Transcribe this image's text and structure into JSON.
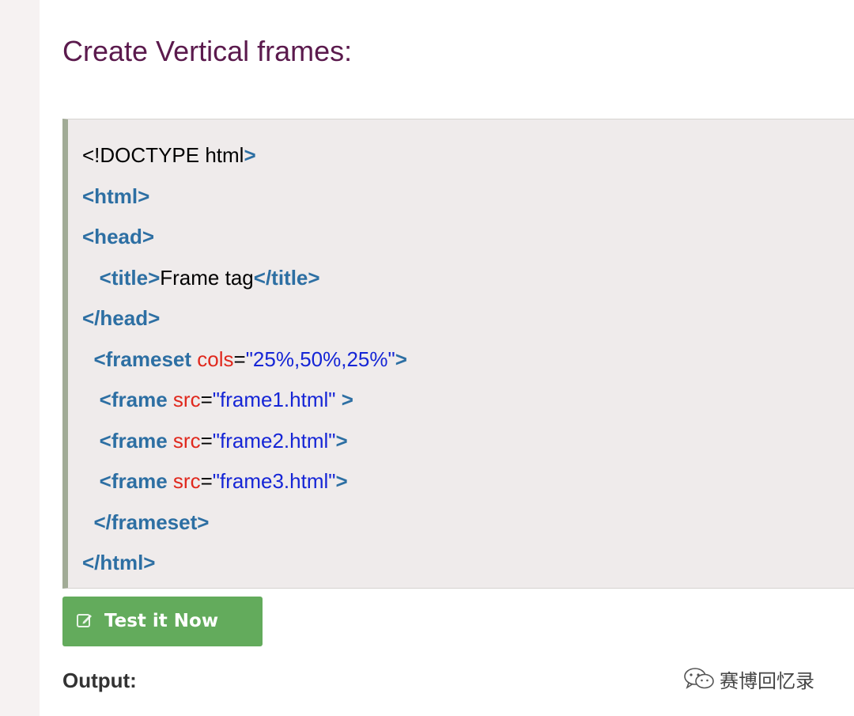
{
  "heading": "Create Vertical frames:",
  "code_lines": [
    [
      {
        "t": "<!DOCTYPE html",
        "c": "plain"
      },
      {
        "t": ">",
        "c": "tag"
      }
    ],
    [
      {
        "t": "<html>",
        "c": "tag"
      }
    ],
    [
      {
        "t": "<head>",
        "c": "tag"
      }
    ],
    [
      {
        "t": "   ",
        "c": "plain"
      },
      {
        "t": "<title>",
        "c": "tag"
      },
      {
        "t": "Frame tag",
        "c": "plain"
      },
      {
        "t": "</title>",
        "c": "tag"
      }
    ],
    [
      {
        "t": "</head>",
        "c": "tag"
      }
    ],
    [
      {
        "t": "  ",
        "c": "plain"
      },
      {
        "t": "<frameset",
        "c": "tag"
      },
      {
        "t": " ",
        "c": "plain"
      },
      {
        "t": "cols",
        "c": "attr"
      },
      {
        "t": "=",
        "c": "plain"
      },
      {
        "t": "\"25%,50%,25%\"",
        "c": "str"
      },
      {
        "t": ">",
        "c": "tag"
      }
    ],
    [
      {
        "t": "   ",
        "c": "plain"
      },
      {
        "t": "<frame",
        "c": "tag"
      },
      {
        "t": " ",
        "c": "plain"
      },
      {
        "t": "src",
        "c": "attr"
      },
      {
        "t": "=",
        "c": "plain"
      },
      {
        "t": "\"frame1.html\"",
        "c": "str"
      },
      {
        "t": " ",
        "c": "plain"
      },
      {
        "t": ">",
        "c": "tag"
      }
    ],
    [
      {
        "t": "   ",
        "c": "plain"
      },
      {
        "t": "<frame",
        "c": "tag"
      },
      {
        "t": " ",
        "c": "plain"
      },
      {
        "t": "src",
        "c": "attr"
      },
      {
        "t": "=",
        "c": "plain"
      },
      {
        "t": "\"frame2.html\"",
        "c": "str"
      },
      {
        "t": ">",
        "c": "tag"
      }
    ],
    [
      {
        "t": "   ",
        "c": "plain"
      },
      {
        "t": "<frame",
        "c": "tag"
      },
      {
        "t": " ",
        "c": "plain"
      },
      {
        "t": "src",
        "c": "attr"
      },
      {
        "t": "=",
        "c": "plain"
      },
      {
        "t": "\"frame3.html\"",
        "c": "str"
      },
      {
        "t": ">",
        "c": "tag"
      }
    ],
    [
      {
        "t": "  ",
        "c": "plain"
      },
      {
        "t": "</frameset>",
        "c": "tag"
      }
    ],
    [
      {
        "t": "</html>",
        "c": "tag"
      }
    ]
  ],
  "test_button": {
    "label": "Test it Now",
    "icon": "edit-icon"
  },
  "output_label": "Output:",
  "watermark": {
    "text": "赛博回忆录",
    "icon": "wechat-icon"
  },
  "colors": {
    "heading": "#5b1a4d",
    "tag": "#2d6fa3",
    "attribute": "#e0281d",
    "string": "#1525d6",
    "code_background": "#efebeb",
    "code_border": "#a1ab96",
    "button": "#63ab5c"
  }
}
